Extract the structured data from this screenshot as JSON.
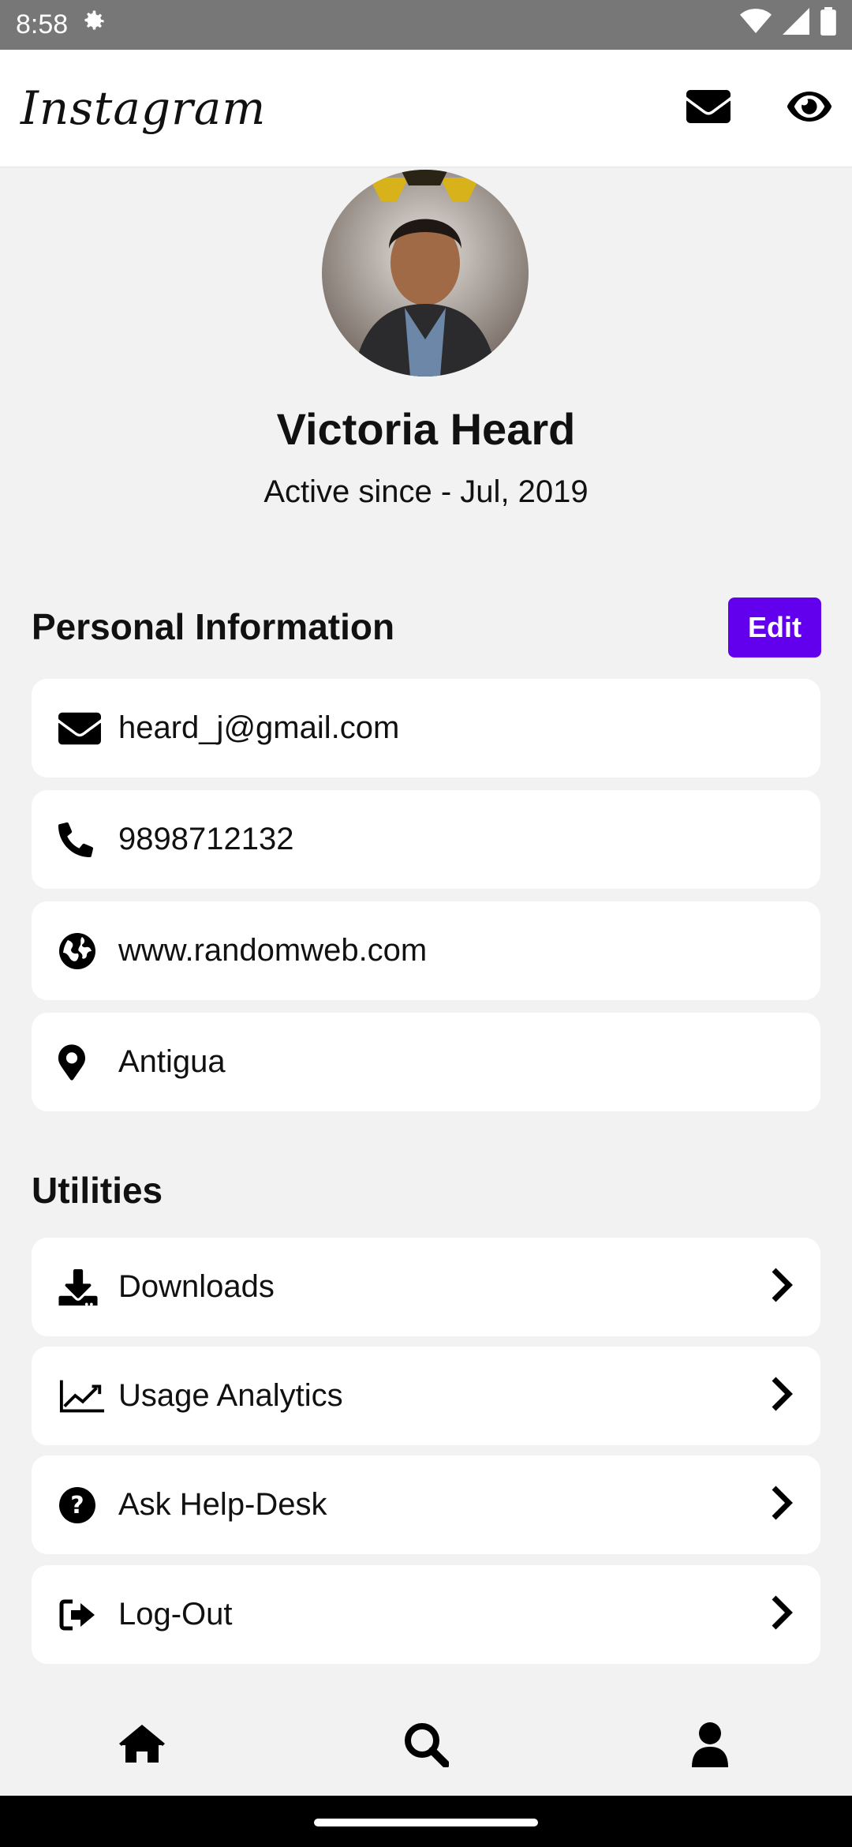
{
  "status": {
    "time": "8:58"
  },
  "header": {
    "logo": "Instagram"
  },
  "profile": {
    "name": "Victoria Heard",
    "since": "Active since - Jul, 2019"
  },
  "personal": {
    "title": "Personal Information",
    "edit_label": "Edit",
    "items": [
      {
        "icon": "envelope-icon",
        "value": "heard_j@gmail.com"
      },
      {
        "icon": "phone-icon",
        "value": "9898712132"
      },
      {
        "icon": "globe-icon",
        "value": "www.randomweb.com"
      },
      {
        "icon": "map-pin-icon",
        "value": "Antigua"
      }
    ]
  },
  "utilities": {
    "title": "Utilities",
    "items": [
      {
        "icon": "download-icon",
        "label": "Downloads"
      },
      {
        "icon": "chart-line-icon",
        "label": "Usage Analytics"
      },
      {
        "icon": "question-circle-icon",
        "label": "Ask Help-Desk"
      },
      {
        "icon": "sign-out-icon",
        "label": "Log-Out"
      }
    ]
  },
  "nav": {
    "items": [
      "home-icon",
      "search-icon",
      "user-icon"
    ]
  },
  "colors": {
    "accent": "#6200ee",
    "status_bar": "#777777",
    "background": "#f2f2f2"
  }
}
